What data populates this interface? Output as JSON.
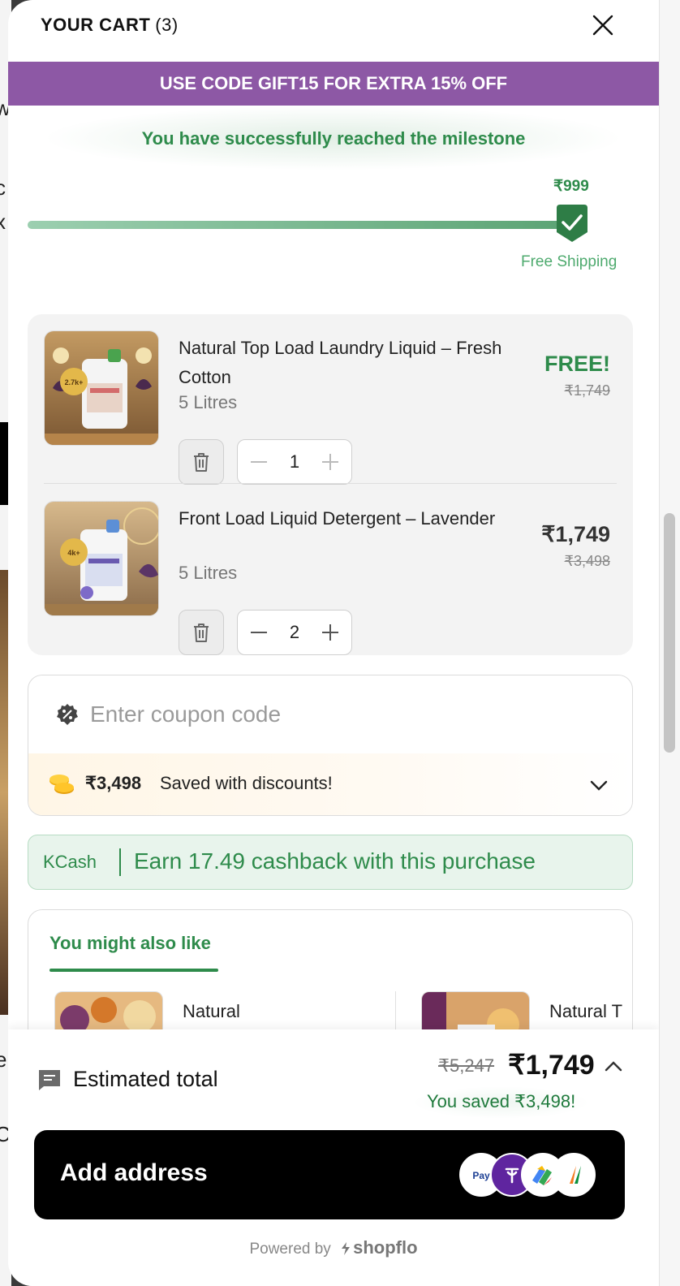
{
  "cart": {
    "title": "YOUR CART",
    "count": "(3)"
  },
  "promo": {
    "text": "USE CODE GIFT15 FOR EXTRA 15% OFF",
    "color": "#8d58a5"
  },
  "milestone": {
    "message": "You have successfully reached the milestone",
    "amount": "₹999",
    "reward": "Free Shipping",
    "progress_percent": 100
  },
  "items": [
    {
      "name": "Natural Top Load Laundry Liquid – Fresh Cotton",
      "variant": "5 Litres",
      "price": "FREE!",
      "original_price": "₹1,749",
      "quantity": "1",
      "badge_line1": "2.7k+",
      "img_icon": "laundry-bottle"
    },
    {
      "name": "Front Load Liquid Detergent – Lavender",
      "variant": "5 Litres",
      "price": "₹1,749",
      "original_price": "₹3,498",
      "quantity": "2",
      "badge_line1": "4k+",
      "img_icon": "detergent-bottle"
    }
  ],
  "coupon": {
    "placeholder": "Enter coupon code",
    "value": ""
  },
  "savings": {
    "amount": "₹3,498",
    "text": "Saved with discounts!"
  },
  "kcash": {
    "logo": "KCash",
    "text": "Earn 17.49 cashback with this purchase"
  },
  "recommendations": {
    "tab_label": "You might also like",
    "items": [
      {
        "name": "Natural"
      },
      {
        "name": "Natural T"
      }
    ]
  },
  "footer": {
    "total_label": "Estimated total",
    "original_total": "₹5,247",
    "final_total": "₹1,749",
    "saved_text": "You saved ₹3,498!",
    "cta_label": "Add address",
    "payment_icons": [
      "paytm-icon",
      "phonepe-icon",
      "gpay-icon",
      "bhim-icon"
    ],
    "powered_by": "Powered by",
    "brand": "shopflo"
  },
  "colors": {
    "accent_green": "#2e8b4b",
    "promo_purple": "#8d58a5",
    "cta_black": "#000000"
  }
}
